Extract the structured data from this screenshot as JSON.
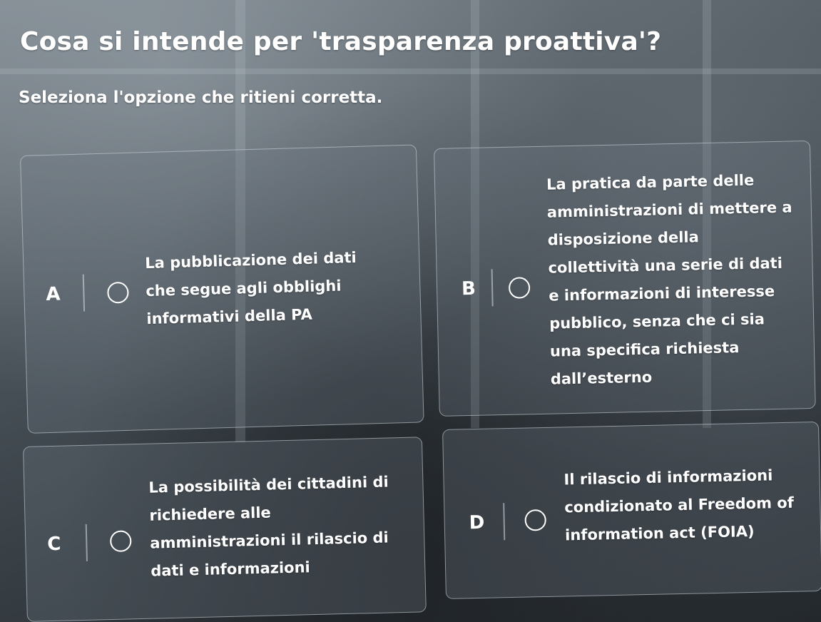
{
  "question": {
    "title": "Cosa si intende per 'trasparenza proattiva'?",
    "instruction": "Seleziona l'opzione che ritieni corretta."
  },
  "options": [
    {
      "letter": "A",
      "text": "La pubblicazione dei dati\nche segue agli obblighi\ninformativi della PA",
      "selected": false
    },
    {
      "letter": "B",
      "text": "La pratica da parte delle\namministrazioni di mettere a\ndisposizione della\ncollettività una serie di dati\ne informazioni di interesse\npubblico, senza che ci sia\nuna specifica richiesta\ndall’esterno",
      "selected": false
    },
    {
      "letter": "C",
      "text": "La possibilità dei cittadini di\nrichiedere alle\namministrazioni il rilascio di\ndati e informazioni",
      "selected": false
    },
    {
      "letter": "D",
      "text": "Il rilascio di informazioni\ncondizionato al Freedom of\ninformation act (FOIA)",
      "selected": false
    }
  ],
  "colors": {
    "text": "#ffffff",
    "card_border": "#d2dae0",
    "background_dark": "#2b3136"
  },
  "icons": {
    "radio": "radio-button-empty-icon"
  }
}
